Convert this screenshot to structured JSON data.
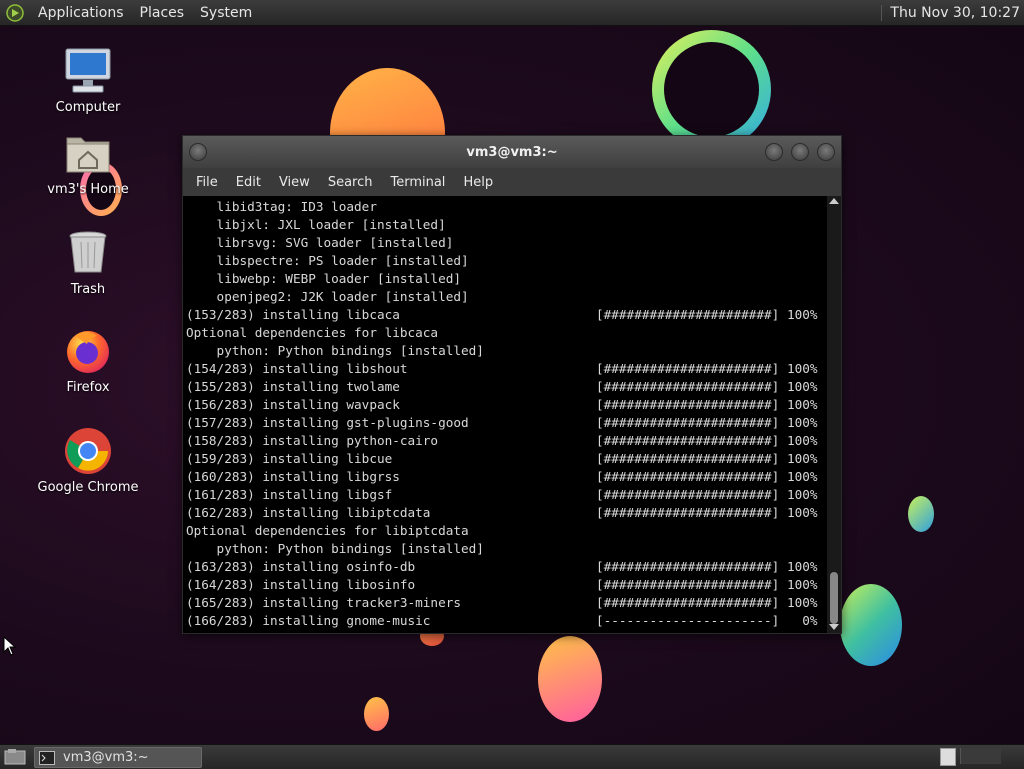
{
  "top_panel": {
    "menus": [
      "Applications",
      "Places",
      "System"
    ],
    "clock": "Thu Nov 30, 10:27"
  },
  "desktop_icons": [
    {
      "label": "Computer",
      "icon": "computer-icon"
    },
    {
      "label": "vm3's Home",
      "icon": "home-folder-icon"
    },
    {
      "label": "Trash",
      "icon": "trash-icon"
    },
    {
      "label": "Firefox",
      "icon": "firefox-icon"
    },
    {
      "label": "Google Chrome",
      "icon": "chrome-icon"
    }
  ],
  "terminal": {
    "title": "vm3@vm3:~",
    "menu": [
      "File",
      "Edit",
      "View",
      "Search",
      "Terminal",
      "Help"
    ],
    "lines": [
      {
        "text": "    libid3tag: ID3 loader"
      },
      {
        "text": "    libjxl: JXL loader [installed]"
      },
      {
        "text": "    librsvg: SVG loader [installed]"
      },
      {
        "text": "    libspectre: PS loader [installed]"
      },
      {
        "text": "    libwebp: WEBP loader [installed]"
      },
      {
        "text": "    openjpeg2: J2K loader [installed]"
      },
      {
        "text": "(153/283) installing libcaca",
        "bar": "[######################] 100%"
      },
      {
        "text": "Optional dependencies for libcaca"
      },
      {
        "text": "    python: Python bindings [installed]"
      },
      {
        "text": "(154/283) installing libshout",
        "bar": "[######################] 100%"
      },
      {
        "text": "(155/283) installing twolame",
        "bar": "[######################] 100%"
      },
      {
        "text": "(156/283) installing wavpack",
        "bar": "[######################] 100%"
      },
      {
        "text": "(157/283) installing gst-plugins-good",
        "bar": "[######################] 100%"
      },
      {
        "text": "(158/283) installing python-cairo",
        "bar": "[######################] 100%"
      },
      {
        "text": "(159/283) installing libcue",
        "bar": "[######################] 100%"
      },
      {
        "text": "(160/283) installing libgrss",
        "bar": "[######################] 100%"
      },
      {
        "text": "(161/283) installing libgsf",
        "bar": "[######################] 100%"
      },
      {
        "text": "(162/283) installing libiptcdata",
        "bar": "[######################] 100%"
      },
      {
        "text": "Optional dependencies for libiptcdata"
      },
      {
        "text": "    python: Python bindings [installed]"
      },
      {
        "text": "(163/283) installing osinfo-db",
        "bar": "[######################] 100%"
      },
      {
        "text": "(164/283) installing libosinfo",
        "bar": "[######################] 100%"
      },
      {
        "text": "(165/283) installing tracker3-miners",
        "bar": "[######################] 100%"
      },
      {
        "text": "(166/283) installing gnome-music",
        "bar": "[----------------------]   0%"
      }
    ]
  },
  "taskbar": {
    "window_label": "vm3@vm3:~"
  }
}
